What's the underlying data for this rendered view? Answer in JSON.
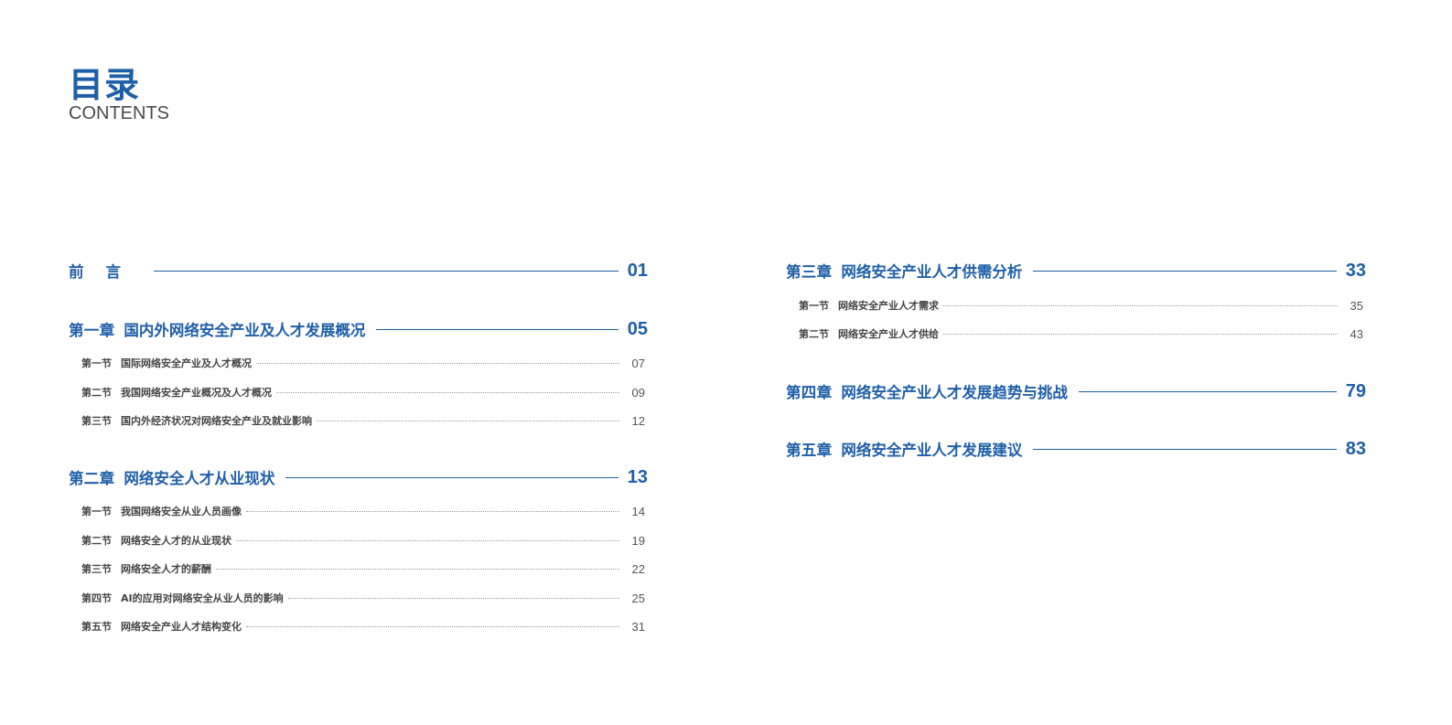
{
  "header": {
    "title": "目录",
    "subtitle": "CONTENTS"
  },
  "left": {
    "preface": {
      "label": "前言",
      "page": "01"
    },
    "ch1": {
      "label": "第一章",
      "title": "国内外网络安全产业及人才发展概况",
      "page": "05",
      "sections": [
        {
          "label": "第一节",
          "title": "国际网络安全产业及人才概况",
          "page": "07"
        },
        {
          "label": "第二节",
          "title": "我国网络安全产业概况及人才概况",
          "page": "09"
        },
        {
          "label": "第三节",
          "title": "国内外经济状况对网络安全产业及就业影响",
          "page": "12"
        }
      ]
    },
    "ch2": {
      "label": "第二章",
      "title": "网络安全人才从业现状",
      "page": "13",
      "sections": [
        {
          "label": "第一节",
          "title": "我国网络安全从业人员画像",
          "page": "14"
        },
        {
          "label": "第二节",
          "title": "网络安全人才的从业现状",
          "page": "19"
        },
        {
          "label": "第三节",
          "title": "网络安全人才的薪酬",
          "page": "22"
        },
        {
          "label": "第四节",
          "title": "AI的应用对网络安全从业人员的影响",
          "page": "25"
        },
        {
          "label": "第五节",
          "title": "网络安全产业人才结构变化",
          "page": "31"
        }
      ]
    }
  },
  "right": {
    "ch3": {
      "label": "第三章",
      "title": "网络安全产业人才供需分析",
      "page": "33",
      "sections": [
        {
          "label": "第一节",
          "title": "网络安全产业人才需求",
          "page": "35"
        },
        {
          "label": "第二节",
          "title": "网络安全产业人才供给",
          "page": "43"
        }
      ]
    },
    "ch4": {
      "label": "第四章",
      "title": "网络安全产业人才发展趋势与挑战",
      "page": "79"
    },
    "ch5": {
      "label": "第五章",
      "title": "网络安全产业人才发展建议",
      "page": "83"
    }
  },
  "colors": {
    "accent": "#1f5fa8",
    "text": "#444444",
    "dots": "#9a9a9a"
  }
}
